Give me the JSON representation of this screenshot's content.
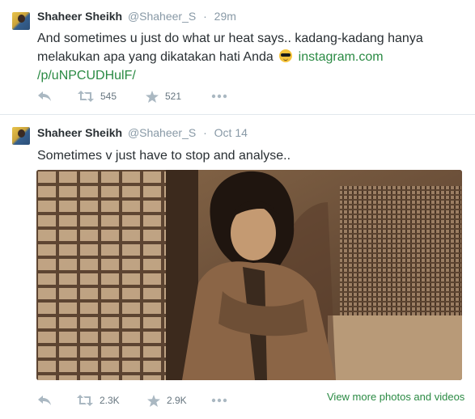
{
  "tweets": [
    {
      "fullname": "Shaheer Sheikh",
      "handle": "@Shaheer_S",
      "dot": "·",
      "time": "29m",
      "text_main": "And sometimes u just do what ur heat says.. kadang-kadang hanya melakukan apa yang dikatakan hati Anda",
      "emoji": "sunglasses-emoji",
      "link_part1": "instagram.com",
      "link_part2": "/p/uNPCUDHulF/",
      "retweets": "545",
      "favorites": "521"
    },
    {
      "fullname": "Shaheer Sheikh",
      "handle": "@Shaheer_S",
      "dot": "·",
      "time": "Oct 14",
      "text_main": "Sometimes v just have to stop and analyse..",
      "retweets": "2.3K",
      "favorites": "2.9K",
      "view_more": "View more photos and videos"
    }
  ],
  "icons": {
    "reply": "reply-icon",
    "retweet": "retweet-icon",
    "favorite": "star-icon",
    "more": "more-icon"
  },
  "colors": {
    "name": "#292f33",
    "meta": "#8899a6",
    "link": "#2b7bb9",
    "green": "#2a8a43",
    "divider": "#e1e8ed"
  }
}
